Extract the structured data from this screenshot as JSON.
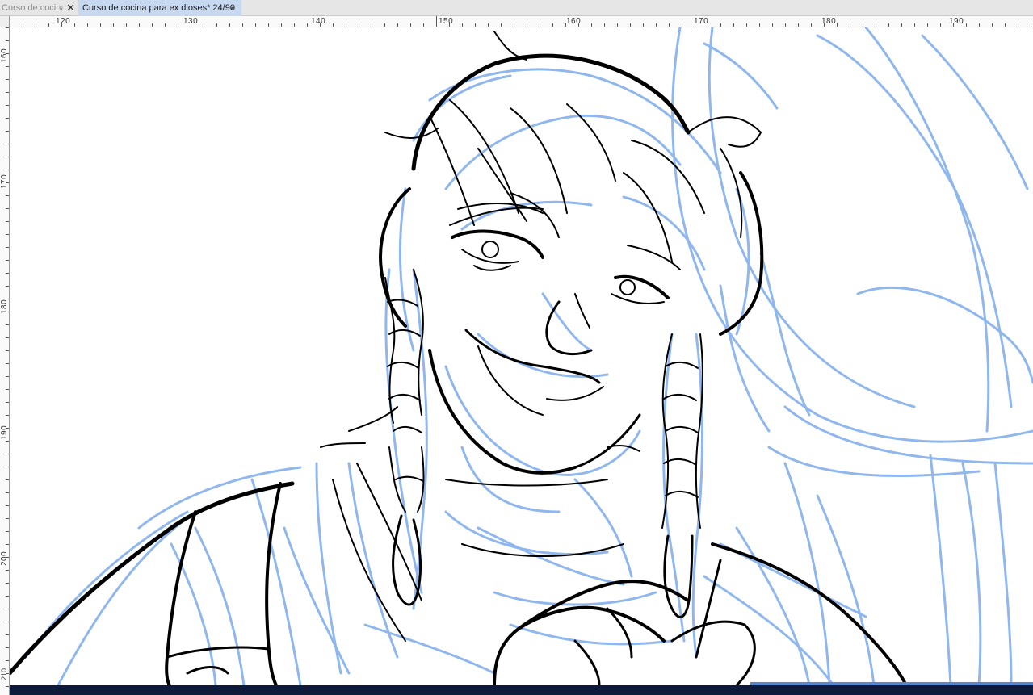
{
  "tabs": [
    {
      "label": "Curso de cocina",
      "active": false
    },
    {
      "label": "Curso de cocina para ex dioses* 24/90",
      "active": true
    }
  ],
  "ruler": {
    "horizontal": [
      "120",
      "130",
      "140",
      "150",
      "160",
      "170",
      "180",
      "190"
    ],
    "vertical": [
      "160",
      "170",
      "180",
      "190",
      "200",
      "210"
    ]
  },
  "colors": {
    "sketch": "#8ab4ee",
    "ink": "#000000",
    "active_tab": "#c6d9f1",
    "bottom_bar": "#0d1a3a"
  },
  "icons": {
    "close": "close-icon",
    "unsaved": "unsaved-dot-icon"
  }
}
